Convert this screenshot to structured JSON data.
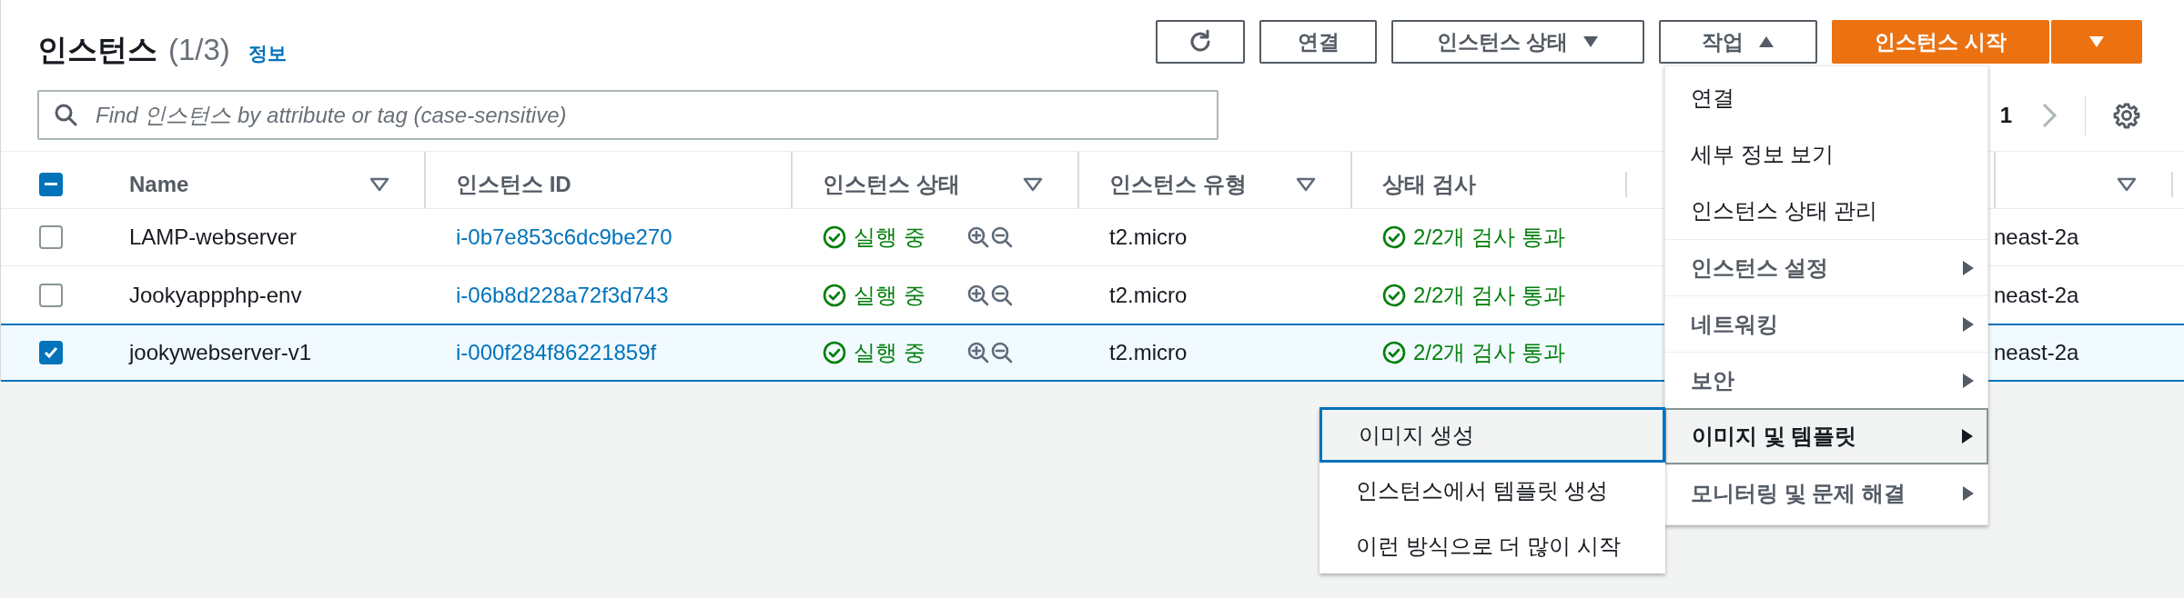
{
  "header": {
    "title": "인스턴스",
    "count": "(1/3)",
    "info_link": "정보"
  },
  "toolbar": {
    "buttons": [
      {
        "kind": "refresh"
      },
      {
        "kind": "plain",
        "label": "연결"
      },
      {
        "kind": "dropdown",
        "label": "인스턴스 상태",
        "expanded": false
      },
      {
        "kind": "dropdown",
        "label": "작업",
        "expanded": true
      },
      {
        "kind": "primary",
        "label": "인스턴스 시작"
      },
      {
        "kind": "primary-caret"
      }
    ]
  },
  "search": {
    "placeholder": "Find 인스턴스 by attribute or tag (case-sensitive)"
  },
  "pagination": {
    "page": "1"
  },
  "table": {
    "select_all": {
      "indeterminate": true
    },
    "columns": [
      {
        "label": "Name",
        "filter": true
      },
      {
        "label": "인스턴스 ID",
        "filter": false
      },
      {
        "label": "인스턴스 상태",
        "filter": true
      },
      {
        "label": "인스턴스 유형",
        "filter": true
      },
      {
        "label": "상태 검사",
        "filter": false
      },
      {
        "filter": true
      }
    ],
    "rows": [
      {
        "name": "LAMP-webserver",
        "instance_id": "i-0b7e853c6dc9be270",
        "state": "실행 중",
        "instance_type": "t2.micro",
        "status_check": "2/2개 검사 통과",
        "availability_zone": "neast-2a",
        "selected": false
      },
      {
        "name": "Jookyappphp-env",
        "instance_id": "i-06b8d228a72f3d743",
        "state": "실행 중",
        "instance_type": "t2.micro",
        "status_check": "2/2개 검사 통과",
        "availability_zone": "neast-2a",
        "selected": false
      },
      {
        "name": "jookywebserver-v1",
        "instance_id": "i-000f284f86221859f",
        "state": "실행 중",
        "instance_type": "t2.micro",
        "status_check": "2/2개 검사 통과",
        "availability_zone": "neast-2a",
        "selected": true
      }
    ]
  },
  "actions_menu": {
    "items": [
      {
        "kind": "action",
        "label": "연결",
        "selected": false
      },
      {
        "kind": "action",
        "label": "세부 정보 보기",
        "selected": false
      },
      {
        "kind": "action",
        "label": "인스턴스 상태 관리",
        "selected": false
      },
      {
        "kind": "submenu",
        "label": "인스턴스 설정",
        "selected": false
      },
      {
        "kind": "submenu",
        "label": "네트워킹",
        "selected": false
      },
      {
        "kind": "submenu",
        "label": "보안",
        "selected": false
      },
      {
        "kind": "submenu",
        "label": "이미지 및 템플릿",
        "selected": true
      },
      {
        "kind": "submenu",
        "label": "모니터링 및 문제 해결",
        "selected": false
      }
    ]
  },
  "submenu": {
    "items": [
      {
        "label": "이미지 생성",
        "selected": true
      },
      {
        "label": "인스턴스에서 템플릿 생성",
        "selected": false
      },
      {
        "label": "이런 방식으로 더 많이 시작",
        "selected": false
      }
    ]
  }
}
